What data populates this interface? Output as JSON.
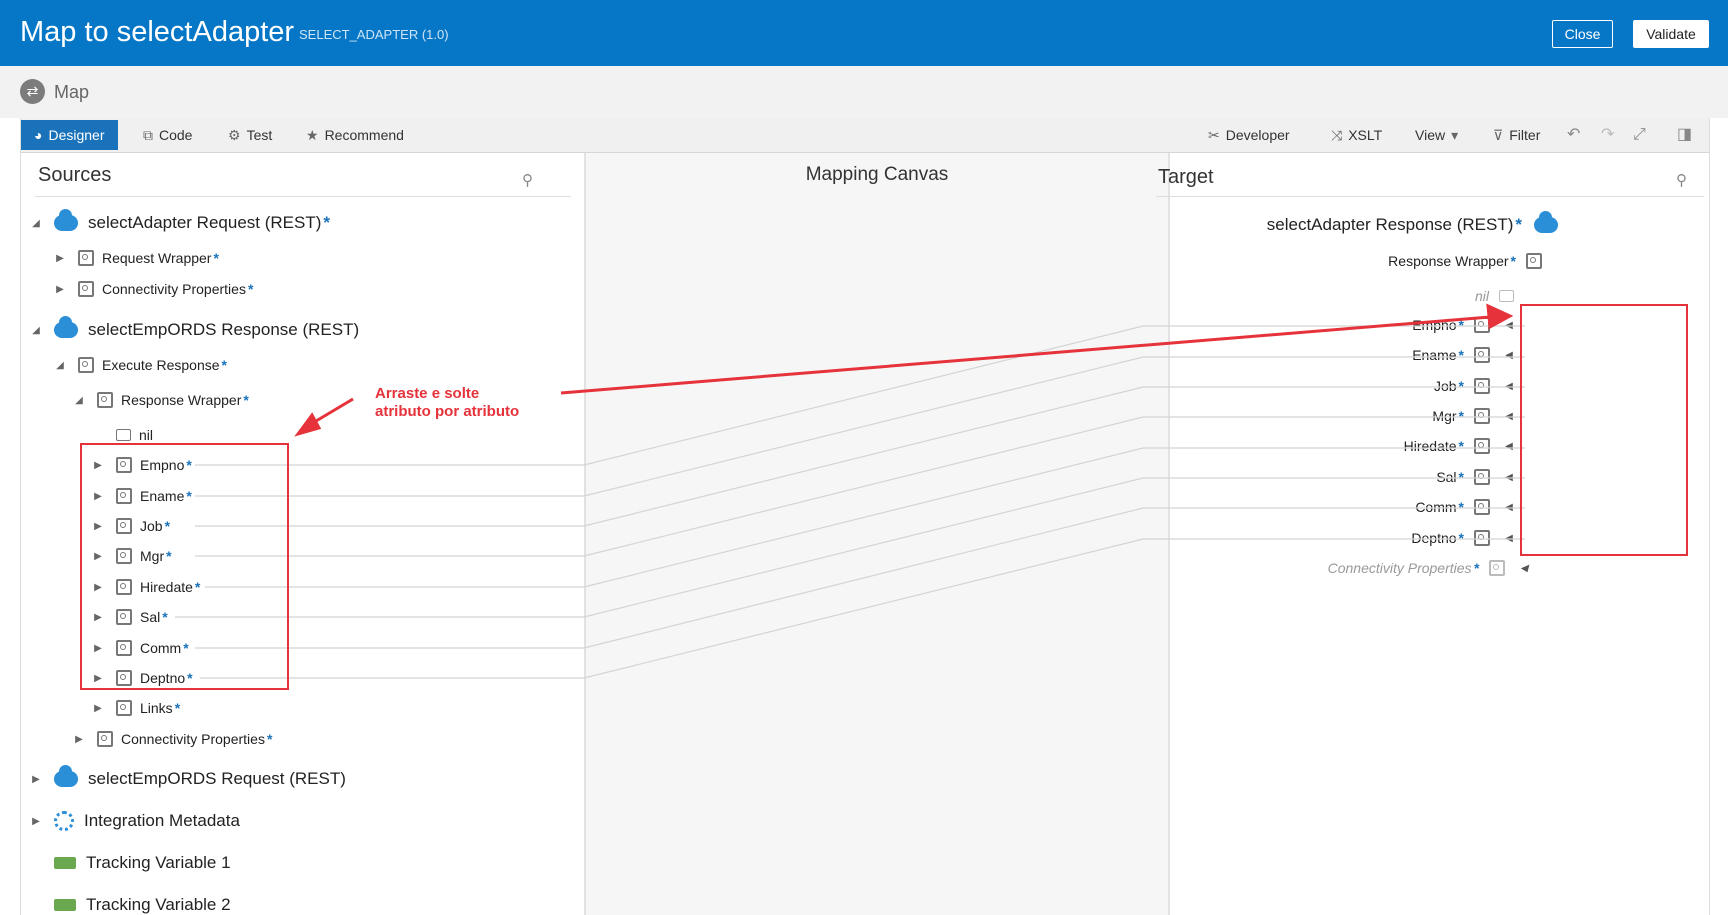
{
  "header": {
    "title": "Map to selectAdapter",
    "subtitle": "SELECT_ADAPTER (1.0)",
    "close_label": "Close",
    "validate_label": "Validate"
  },
  "breadcrumb": {
    "label": "Map"
  },
  "toolbar": {
    "tabs": [
      {
        "label": "Designer",
        "icon": "designer-icon",
        "active": true
      },
      {
        "label": "Code",
        "icon": "code-icon"
      },
      {
        "label": "Test",
        "icon": "gear-icon"
      },
      {
        "label": "Recommend",
        "icon": "star-icon"
      }
    ],
    "tools": [
      {
        "label": "Developer",
        "icon": "tools-icon"
      },
      {
        "label": "XSLT",
        "icon": "xslt-icon"
      },
      {
        "label": "View",
        "icon": "chevron-down-icon"
      },
      {
        "label": "Filter",
        "icon": "filter-icon"
      }
    ],
    "icon_buttons": [
      "undo-icon",
      "redo-icon",
      "expand-icon",
      "panel-toggle-icon"
    ]
  },
  "sources": {
    "title": "Sources",
    "tree": [
      {
        "label": "selectAdapter Request (REST)",
        "required": true
      },
      {
        "label": "Request Wrapper",
        "required": true
      },
      {
        "label": "Connectivity Properties",
        "required": true
      },
      {
        "label": "selectEmpORDS Response (REST)",
        "required": false
      },
      {
        "label": "Execute Response",
        "required": true
      },
      {
        "label": "Response Wrapper",
        "required": true
      },
      {
        "label": "nil",
        "required": false
      },
      {
        "label": "Empno",
        "required": true
      },
      {
        "label": "Ename",
        "required": true
      },
      {
        "label": "Job",
        "required": true
      },
      {
        "label": "Mgr",
        "required": true
      },
      {
        "label": "Hiredate",
        "required": true
      },
      {
        "label": "Sal",
        "required": true
      },
      {
        "label": "Comm",
        "required": true
      },
      {
        "label": "Deptno",
        "required": true
      },
      {
        "label": "Links",
        "required": true
      },
      {
        "label": "Connectivity Properties",
        "required": true
      },
      {
        "label": "selectEmpORDS Request (REST)",
        "required": false
      },
      {
        "label": "Integration Metadata",
        "required": false
      },
      {
        "label": "Tracking Variable 1",
        "required": false
      },
      {
        "label": "Tracking Variable 2",
        "required": false
      }
    ]
  },
  "canvas": {
    "title": "Mapping Canvas"
  },
  "target": {
    "title": "Target",
    "tree": [
      {
        "label": "selectAdapter Response (REST)",
        "required": true
      },
      {
        "label": "Response Wrapper",
        "required": true
      },
      {
        "label": "nil",
        "required": false
      },
      {
        "label": "Empno",
        "required": true
      },
      {
        "label": "Ename",
        "required": true
      },
      {
        "label": "Job",
        "required": true
      },
      {
        "label": "Mgr",
        "required": true
      },
      {
        "label": "Hiredate",
        "required": true
      },
      {
        "label": "Sal",
        "required": true
      },
      {
        "label": "Comm",
        "required": true
      },
      {
        "label": "Deptno",
        "required": true
      },
      {
        "label": "Connectivity Properties",
        "required": true
      }
    ]
  },
  "annotation": {
    "line1": "Arraste e solte",
    "line2": "atributo por atributo",
    "color": "#e5323b"
  },
  "colors": {
    "header": "#0677c6",
    "accent": "#1a73ba"
  },
  "required_marker": "*"
}
